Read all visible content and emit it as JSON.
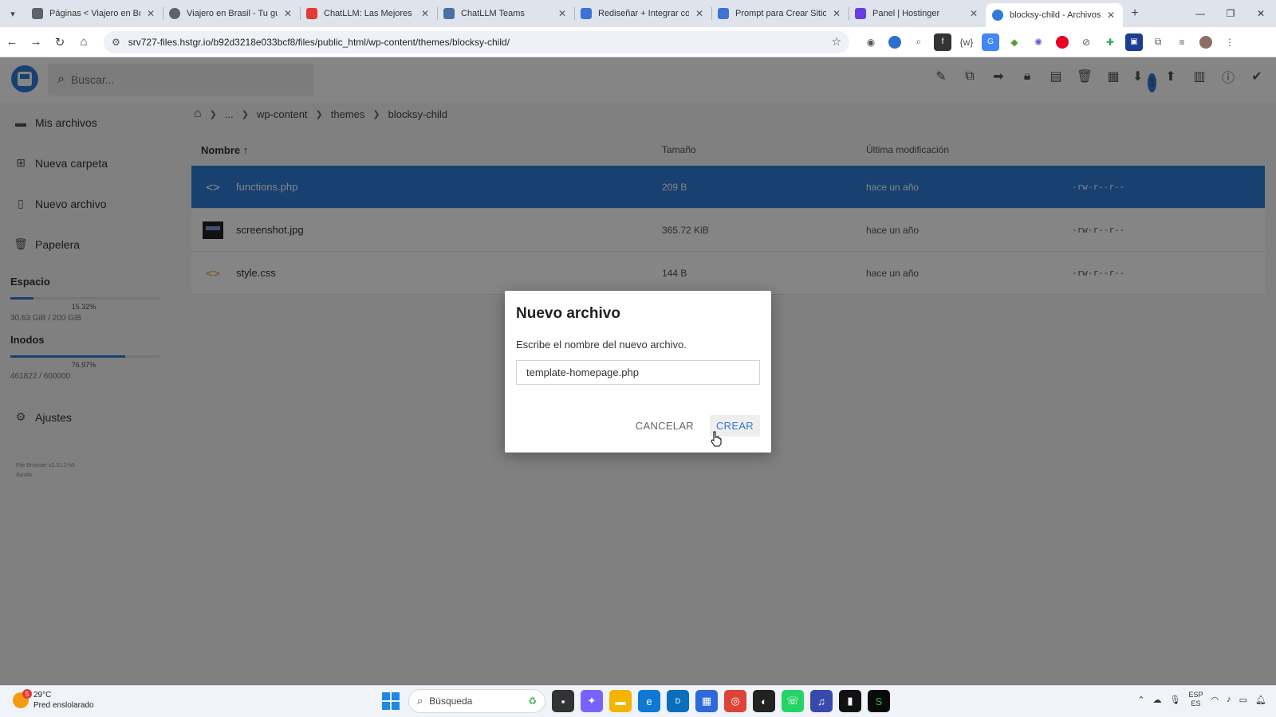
{
  "browser": {
    "tabs": [
      {
        "label": "Páginas < Viajero en Bras",
        "color": "#5f6368"
      },
      {
        "label": "Viajero en Brasil - Tu guía",
        "color": "#5f6368"
      },
      {
        "label": "ChatLLM: Las Mejores IA",
        "color": "#e53935"
      },
      {
        "label": "ChatLLM Teams",
        "color": "#4a6fa5"
      },
      {
        "label": "Rediseñar + Integrar con",
        "color": "#3b73d6"
      },
      {
        "label": "Prompt para Crear Sitios",
        "color": "#3b73d6"
      },
      {
        "label": "Panel | Hostinger",
        "color": "#673de6"
      },
      {
        "label": "blocksy-child - Archivos -",
        "color": "#2f7bd8"
      }
    ],
    "url": "srv727-files.hstgr.io/b92d3218e033bcf8/files/public_html/wp-content/themes/blocksy-child/"
  },
  "app": {
    "search_placeholder": "Buscar...",
    "notification_count": "1"
  },
  "sidebar": {
    "items": [
      {
        "label": "Mis archivos"
      },
      {
        "label": "Nueva carpeta"
      },
      {
        "label": "Nuevo archivo"
      },
      {
        "label": "Papelera"
      }
    ],
    "space": {
      "title": "Espacio",
      "percent": "15.32%",
      "fraction": 0.1532,
      "total": "30.63 GiB / 200 GiB"
    },
    "inodes": {
      "title": "Inodos",
      "percent": "76.97%",
      "fraction": 0.7697,
      "total": "461822 / 600000"
    },
    "settings_label": "Ajustes",
    "credit_line1": "File Browser v2.31.2-h5",
    "credit_line2": "Ayuda"
  },
  "breadcrumbs": [
    "...",
    "wp-content",
    "themes",
    "blocksy-child"
  ],
  "table": {
    "headers": {
      "name": "Nombre",
      "size": "Tamaño",
      "modified": "Última modificación"
    },
    "rows": [
      {
        "name": "functions.php",
        "size": "209 B",
        "modified": "hace un año",
        "perm": "-rw-r--r--",
        "icon": "code-icon"
      },
      {
        "name": "screenshot.jpg",
        "size": "365.72 KiB",
        "modified": "hace un año",
        "perm": "-rw-r--r--",
        "icon": "image-thumbnail"
      },
      {
        "name": "style.css",
        "size": "144 B",
        "modified": "hace un año",
        "perm": "-rw-r--r--",
        "icon": "code-icon"
      }
    ]
  },
  "dialog": {
    "title": "Nuevo archivo",
    "message": "Escribe el nombre del nuevo archivo.",
    "input_value": "template-homepage.php",
    "cancel_label": "CANCELAR",
    "create_label": "CREAR"
  },
  "taskbar": {
    "temperature": "29°C",
    "weather": "Pred enslolarado",
    "weather_badge": "5",
    "search_label": "Búsqueda",
    "lang_line1": "ESP",
    "lang_line2": "ES"
  },
  "colors": {
    "accent": "#2f7bd8",
    "code_icon": "#f0a030"
  }
}
